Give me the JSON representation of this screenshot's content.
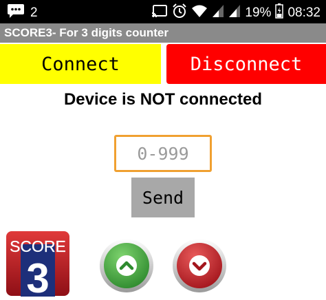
{
  "status_bar": {
    "notification_count": "2",
    "battery_percent": "19%",
    "time": "08:32",
    "icons": [
      "chat-bubble-icon",
      "cast-icon",
      "alarm-icon",
      "wifi-icon",
      "signal-icon",
      "signal-icon",
      "battery-icon"
    ]
  },
  "app": {
    "title": "SCORE3- For 3 digits counter"
  },
  "connection": {
    "connect_label": "Connect",
    "disconnect_label": "Disconnect",
    "status": "Device is NOT connected",
    "connect_color": "#ffff00",
    "disconnect_color": "#ff0000"
  },
  "counter": {
    "placeholder": "0-999",
    "send_label": "Send"
  },
  "logo": {
    "line1": "SCORE",
    "line2": "3"
  },
  "controls": {
    "up_icon": "chevron-up-icon",
    "down_icon": "chevron-down-icon",
    "up_color": "#3fa53f",
    "down_color": "#c8232a"
  }
}
